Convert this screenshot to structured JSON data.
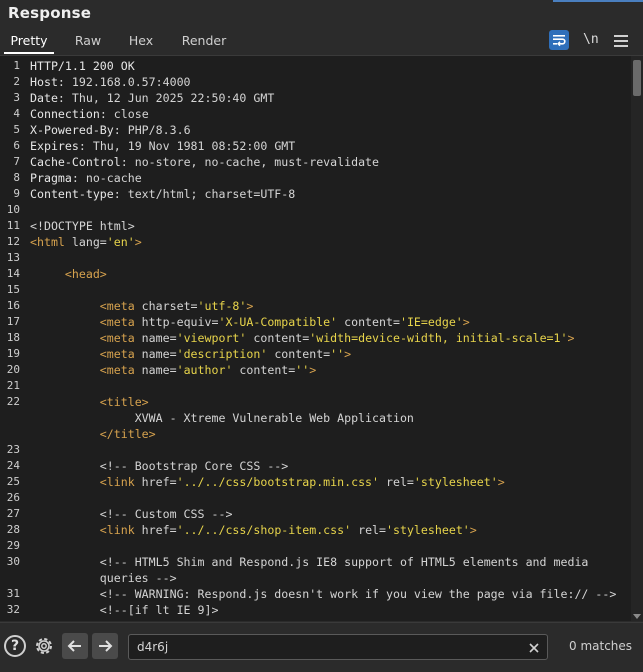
{
  "panel": {
    "title": "Response"
  },
  "tabs": [
    {
      "label": "Pretty",
      "active": true
    },
    {
      "label": "Raw",
      "active": false
    },
    {
      "label": "Hex",
      "active": false
    },
    {
      "label": "Render",
      "active": false
    }
  ],
  "toolbar": {
    "wrap_icon": "word-wrap-icon",
    "newline_label": "\\n",
    "menu_icon": "hamburger-menu-icon",
    "accent_color": "#2f6fba"
  },
  "colors": {
    "tag": "#d6a24e",
    "attr_value": "#e7d44b",
    "text": "#d4d4d4",
    "editor_bg": "#1e1e1e"
  },
  "lines": [
    {
      "n": "1",
      "parts": [
        {
          "k": "hk",
          "t": "HTTP/1.1 200 OK"
        }
      ]
    },
    {
      "n": "2",
      "parts": [
        {
          "k": "hk",
          "t": "Host"
        },
        {
          "k": "hv",
          "t": ": 192.168.0.57:4000"
        }
      ]
    },
    {
      "n": "3",
      "parts": [
        {
          "k": "hk",
          "t": "Date"
        },
        {
          "k": "hv",
          "t": ": Thu, 12 Jun 2025 22:50:40 GMT"
        }
      ]
    },
    {
      "n": "4",
      "parts": [
        {
          "k": "hk",
          "t": "Connection"
        },
        {
          "k": "hv",
          "t": ": close"
        }
      ]
    },
    {
      "n": "5",
      "parts": [
        {
          "k": "hk",
          "t": "X-Powered-By"
        },
        {
          "k": "hv",
          "t": ": PHP/8.3.6"
        }
      ]
    },
    {
      "n": "6",
      "parts": [
        {
          "k": "hk",
          "t": "Expires"
        },
        {
          "k": "hv",
          "t": ": Thu, 19 Nov 1981 08:52:00 GMT"
        }
      ]
    },
    {
      "n": "7",
      "parts": [
        {
          "k": "hk",
          "t": "Cache-Control"
        },
        {
          "k": "hv",
          "t": ": no-store, no-cache, must-revalidate"
        }
      ]
    },
    {
      "n": "8",
      "parts": [
        {
          "k": "hk",
          "t": "Pragma"
        },
        {
          "k": "hv",
          "t": ": no-cache"
        }
      ]
    },
    {
      "n": "9",
      "parts": [
        {
          "k": "hk",
          "t": "Content-type"
        },
        {
          "k": "hv",
          "t": ": text/html; charset=UTF-8"
        }
      ]
    },
    {
      "n": "10",
      "parts": []
    },
    {
      "n": "11",
      "parts": [
        {
          "k": "tx",
          "t": "<!DOCTYPE html>"
        }
      ]
    },
    {
      "n": "12",
      "parts": [
        {
          "k": "tg",
          "t": "<html"
        },
        {
          "k": "at",
          "t": " lang="
        },
        {
          "k": "av",
          "t": "'en'"
        },
        {
          "k": "tg",
          "t": ">"
        }
      ]
    },
    {
      "n": "13",
      "parts": []
    },
    {
      "n": "14",
      "parts": [
        {
          "k": "tg",
          "t": "     <head>"
        }
      ]
    },
    {
      "n": "15",
      "parts": []
    },
    {
      "n": "16",
      "parts": [
        {
          "k": "tg",
          "t": "          <meta"
        },
        {
          "k": "at",
          "t": " charset="
        },
        {
          "k": "av",
          "t": "'utf-8'"
        },
        {
          "k": "tg",
          "t": ">"
        }
      ]
    },
    {
      "n": "17",
      "parts": [
        {
          "k": "tg",
          "t": "          <meta"
        },
        {
          "k": "at",
          "t": " http-equiv="
        },
        {
          "k": "av",
          "t": "'X-UA-Compatible'"
        },
        {
          "k": "at",
          "t": " content="
        },
        {
          "k": "av",
          "t": "'IE=edge'"
        },
        {
          "k": "tg",
          "t": ">"
        }
      ]
    },
    {
      "n": "18",
      "parts": [
        {
          "k": "tg",
          "t": "          <meta"
        },
        {
          "k": "at",
          "t": " name="
        },
        {
          "k": "av",
          "t": "'viewport'"
        },
        {
          "k": "at",
          "t": " content="
        },
        {
          "k": "av",
          "t": "'width=device-width, initial-scale=1'"
        },
        {
          "k": "tg",
          "t": ">"
        }
      ]
    },
    {
      "n": "19",
      "parts": [
        {
          "k": "tg",
          "t": "          <meta"
        },
        {
          "k": "at",
          "t": " name="
        },
        {
          "k": "av",
          "t": "'description'"
        },
        {
          "k": "at",
          "t": " content="
        },
        {
          "k": "av",
          "t": "''"
        },
        {
          "k": "tg",
          "t": ">"
        }
      ]
    },
    {
      "n": "20",
      "parts": [
        {
          "k": "tg",
          "t": "          <meta"
        },
        {
          "k": "at",
          "t": " name="
        },
        {
          "k": "av",
          "t": "'author'"
        },
        {
          "k": "at",
          "t": " content="
        },
        {
          "k": "av",
          "t": "''"
        },
        {
          "k": "tg",
          "t": ">"
        }
      ]
    },
    {
      "n": "21",
      "parts": []
    },
    {
      "n": "22",
      "parts": [
        {
          "k": "tg",
          "t": "          <title>"
        }
      ]
    },
    {
      "n": "",
      "parts": [
        {
          "k": "tx",
          "t": "               XVWA - Xtreme Vulnerable Web Application"
        }
      ]
    },
    {
      "n": "",
      "parts": [
        {
          "k": "tg",
          "t": "          </title>"
        }
      ]
    },
    {
      "n": "23",
      "parts": []
    },
    {
      "n": "24",
      "parts": [
        {
          "k": "cm",
          "t": "          <!-- Bootstrap Core CSS -->"
        }
      ]
    },
    {
      "n": "25",
      "parts": [
        {
          "k": "tg",
          "t": "          <link"
        },
        {
          "k": "at",
          "t": " href="
        },
        {
          "k": "av",
          "t": "'../../css/bootstrap.min.css'"
        },
        {
          "k": "at",
          "t": " rel="
        },
        {
          "k": "av",
          "t": "'stylesheet'"
        },
        {
          "k": "tg",
          "t": ">"
        }
      ]
    },
    {
      "n": "26",
      "parts": []
    },
    {
      "n": "27",
      "parts": [
        {
          "k": "cm",
          "t": "          <!-- Custom CSS -->"
        }
      ]
    },
    {
      "n": "28",
      "parts": [
        {
          "k": "tg",
          "t": "          <link"
        },
        {
          "k": "at",
          "t": " href="
        },
        {
          "k": "av",
          "t": "'../../css/shop-item.css'"
        },
        {
          "k": "at",
          "t": " rel="
        },
        {
          "k": "av",
          "t": "'stylesheet'"
        },
        {
          "k": "tg",
          "t": ">"
        }
      ]
    },
    {
      "n": "29",
      "parts": []
    },
    {
      "n": "30",
      "parts": [
        {
          "k": "cm",
          "t": "          <!-- HTML5 Shim and Respond.js IE8 support of HTML5 elements and media"
        }
      ]
    },
    {
      "n": "",
      "parts": [
        {
          "k": "cm",
          "t": "          queries -->"
        }
      ]
    },
    {
      "n": "31",
      "parts": [
        {
          "k": "cm",
          "t": "          <!-- WARNING: Respond.js doesn't work if you view the page via file:// -->"
        }
      ]
    },
    {
      "n": "32",
      "parts": [
        {
          "k": "cm",
          "t": "          <!--[if lt IE 9]>"
        }
      ]
    }
  ],
  "search": {
    "value": "d4r6j",
    "matches_label": "0 matches"
  }
}
